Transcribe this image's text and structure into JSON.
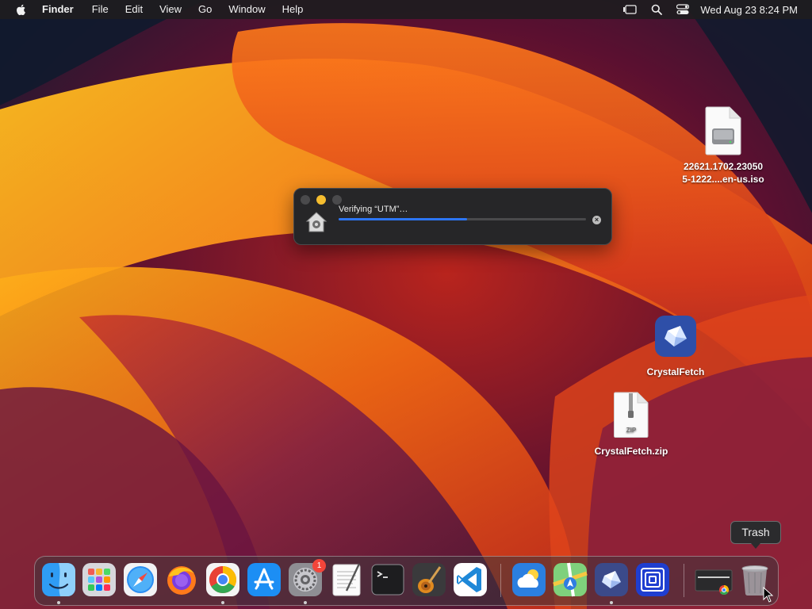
{
  "menubar": {
    "app_name": "Finder",
    "items": [
      "File",
      "Edit",
      "View",
      "Go",
      "Window",
      "Help"
    ],
    "clock": "Wed Aug 23  8:24 PM"
  },
  "desktop": {
    "iso_file": {
      "line1": "22621.1702.23050",
      "line2": "5-1222....en-us.iso"
    },
    "app": {
      "label": "CrystalFetch"
    },
    "zip": {
      "label": "CrystalFetch.zip",
      "badge": "ZIP"
    }
  },
  "progress_window": {
    "title": "Verifying “UTM”…",
    "progress_percent": 52
  },
  "dock": {
    "apps": [
      {
        "name": "finder",
        "running": true
      },
      {
        "name": "launchpad",
        "running": false
      },
      {
        "name": "safari",
        "running": false
      },
      {
        "name": "firefox",
        "running": false
      },
      {
        "name": "chrome",
        "running": true
      },
      {
        "name": "app-store",
        "running": false
      },
      {
        "name": "system-settings",
        "running": true,
        "badge": "1"
      },
      {
        "name": "textedit",
        "running": false
      },
      {
        "name": "terminal",
        "running": false
      },
      {
        "name": "garageband",
        "running": false
      },
      {
        "name": "vscode",
        "running": false
      },
      {
        "name": "weather",
        "running": false
      },
      {
        "name": "maps",
        "running": false
      },
      {
        "name": "crystalfetch",
        "running": true
      },
      {
        "name": "utm",
        "running": false
      }
    ],
    "tooltip": "Trash"
  },
  "colors": {
    "accent": "#2d76f6",
    "badge": "#f3453a",
    "minimize": "#f5bd2f"
  }
}
